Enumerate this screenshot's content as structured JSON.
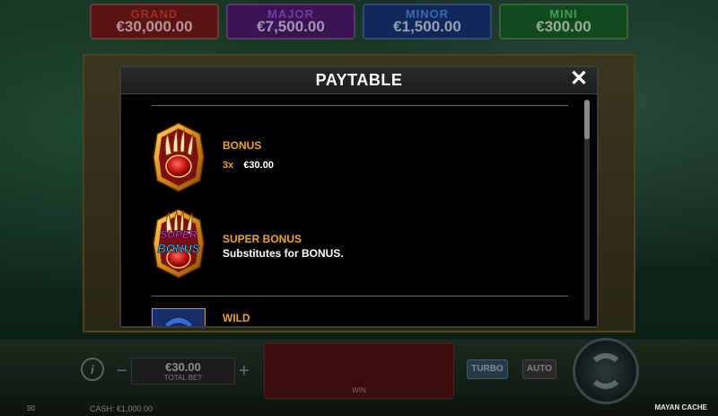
{
  "jackpots": [
    {
      "name": "GRAND",
      "value": "€30,000.00"
    },
    {
      "name": "MAJOR",
      "value": "€7,500.00"
    },
    {
      "name": "MINOR",
      "value": "€1,500.00"
    },
    {
      "name": "MINI",
      "value": "€300.00"
    }
  ],
  "bottom_bar": {
    "info_label": "i",
    "minus_label": "−",
    "plus_label": "+",
    "bet_value": "€30.00",
    "bet_label": "TOTAL BET",
    "win_label": "WIN",
    "turbo_label": "TURBO",
    "auto_label": "AUTO",
    "cash_text": "CASH: €1,000.00",
    "game_title": "MAYAN CACHE"
  },
  "paytable": {
    "title": "PAYTABLE",
    "close_label": "✕",
    "symbols": [
      {
        "name": "BONUS",
        "icon": "bear-claw-bonus-icon",
        "pays": [
          {
            "mult": "3x",
            "amount": "€30.00"
          }
        ]
      },
      {
        "name": "SUPER BONUS",
        "icon": "super-bonus-icon",
        "icon_text": "SUPER BONUS",
        "description": "Substitutes for BONUS."
      },
      {
        "name": "WILD",
        "icon": "wild-icon"
      }
    ]
  },
  "colors": {
    "accent_gold": "#f0a020",
    "modal_bg": "#000000",
    "header_bg": "#222222"
  }
}
